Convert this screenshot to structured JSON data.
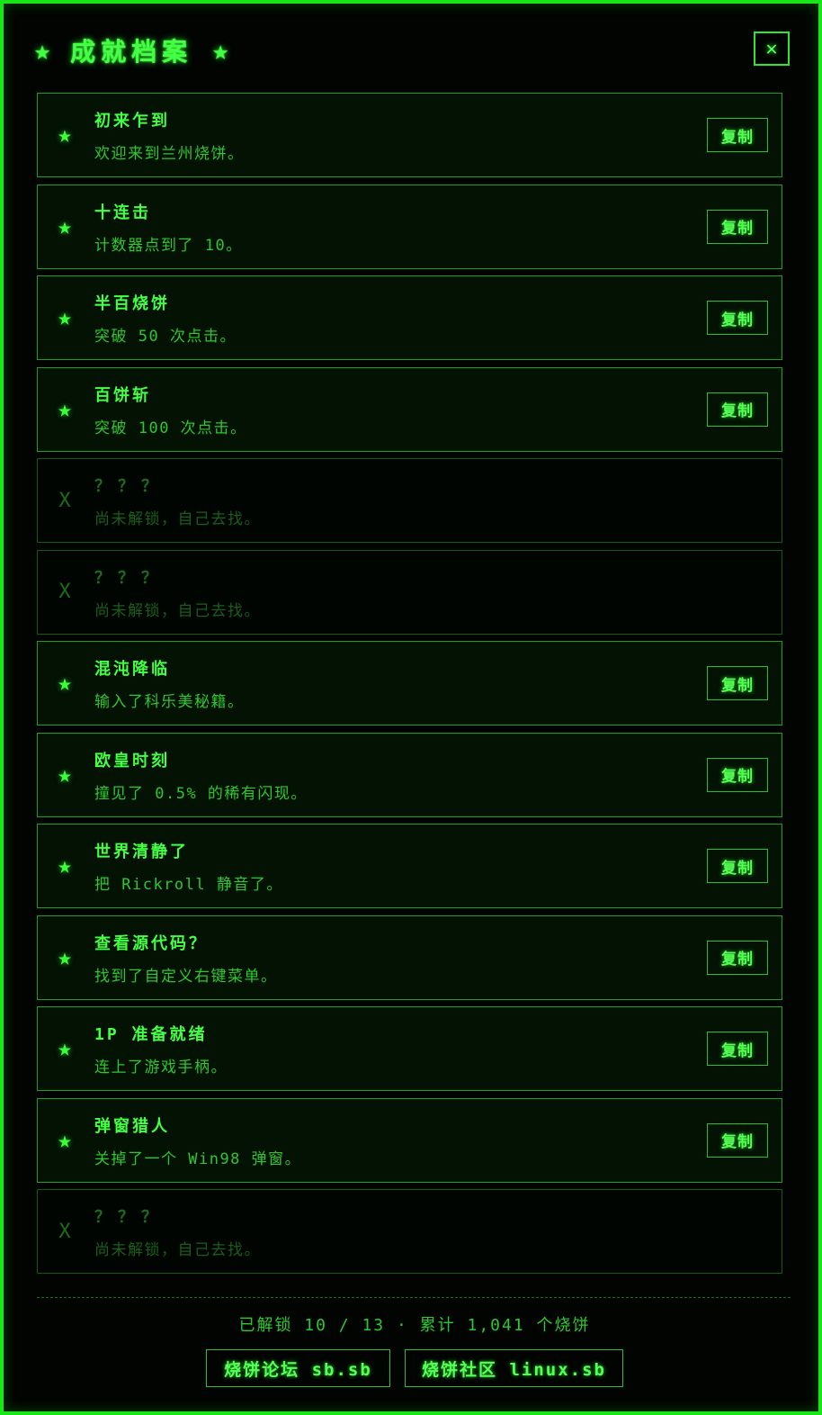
{
  "header": {
    "title": "成就档案",
    "star_left": "★",
    "star_right": "★",
    "close_label": "✕"
  },
  "achievements": [
    {
      "title": "初来乍到",
      "desc": "欢迎来到兰州烧饼。",
      "icon": "★",
      "unlocked": true,
      "copy_label": "复制"
    },
    {
      "title": "十连击",
      "desc": "计数器点到了 10。",
      "icon": "★",
      "unlocked": true,
      "copy_label": "复制"
    },
    {
      "title": "半百烧饼",
      "desc": "突破 50 次点击。",
      "icon": "★",
      "unlocked": true,
      "copy_label": "复制"
    },
    {
      "title": "百饼斩",
      "desc": "突破 100 次点击。",
      "icon": "★",
      "unlocked": true,
      "copy_label": "复制"
    },
    {
      "title": "？？？",
      "desc": "尚未解锁，自己去找。",
      "icon": "X",
      "unlocked": false
    },
    {
      "title": "？？？",
      "desc": "尚未解锁，自己去找。",
      "icon": "X",
      "unlocked": false
    },
    {
      "title": "混沌降临",
      "desc": "输入了科乐美秘籍。",
      "icon": "★",
      "unlocked": true,
      "copy_label": "复制"
    },
    {
      "title": "欧皇时刻",
      "desc": "撞见了 0.5% 的稀有闪现。",
      "icon": "★",
      "unlocked": true,
      "copy_label": "复制"
    },
    {
      "title": "世界清静了",
      "desc": "把 Rickroll 静音了。",
      "icon": "★",
      "unlocked": true,
      "copy_label": "复制"
    },
    {
      "title": "查看源代码？",
      "desc": "找到了自定义右键菜单。",
      "icon": "★",
      "unlocked": true,
      "copy_label": "复制"
    },
    {
      "title": "1P 准备就绪",
      "desc": "连上了游戏手柄。",
      "icon": "★",
      "unlocked": true,
      "copy_label": "复制"
    },
    {
      "title": "弹窗猎人",
      "desc": "关掉了一个 Win98 弹窗。",
      "icon": "★",
      "unlocked": true,
      "copy_label": "复制"
    },
    {
      "title": "？？？",
      "desc": "尚未解锁，自己去找。",
      "icon": "X",
      "unlocked": false
    }
  ],
  "footer": {
    "summary": "已解锁 10 / 13 · 累计 1,041 个烧饼",
    "link_forum": "烧饼论坛 sb.sb",
    "link_community": "烧饼社区 linux.sb"
  },
  "colors": {
    "accent": "#3cff3c",
    "border": "#19e619",
    "locked": "#1d6b1d",
    "background": "#000000"
  }
}
